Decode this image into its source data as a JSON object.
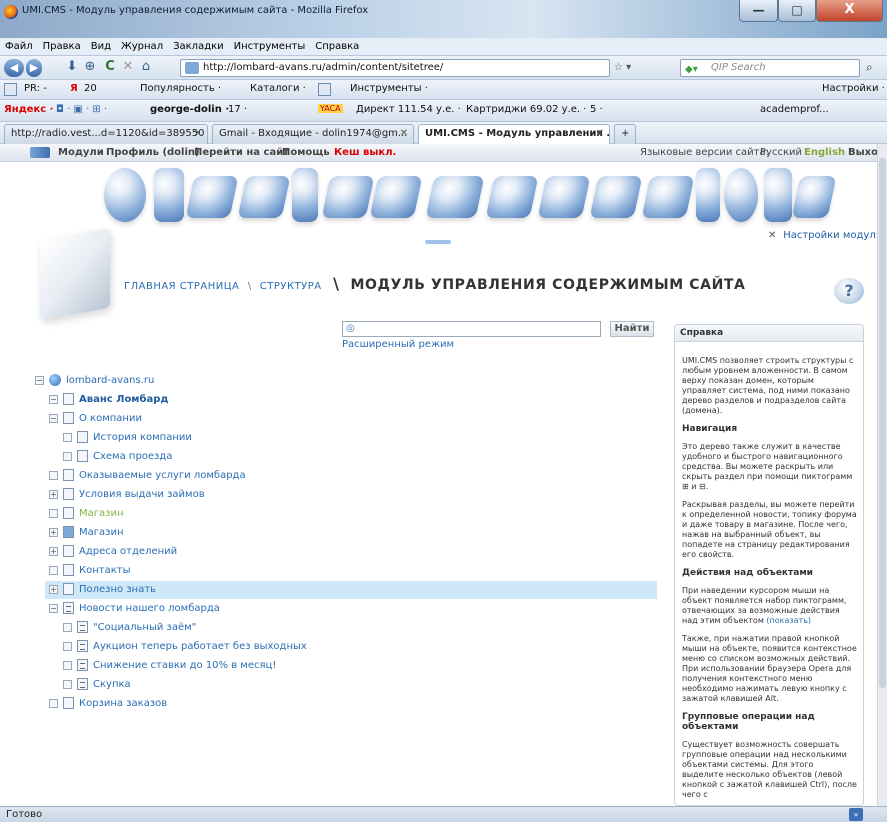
{
  "window": {
    "title": "UMI.CMS - Модуль управления содержимым сайта - Mozilla Firefox",
    "min": "—",
    "max": "□",
    "close": "X"
  },
  "menu": [
    "Файл",
    "Правка",
    "Вид",
    "Журнал",
    "Закладки",
    "Инструменты",
    "Справка"
  ],
  "nav": {
    "url": "http://lombard-avans.ru/admin/content/sitetree/",
    "search_placeholder": "QIP Search",
    "reload": "C",
    "stop": "✕",
    "home": "⌂"
  },
  "toolbar2": {
    "pr": "PR: -",
    "ya": "20",
    "popularity": "Популярность ·",
    "catalogs": "Каталоги ·",
    "tools": "Инструменты ·",
    "settings": "Настройки ·"
  },
  "yabar": {
    "yandex": "Яндекс ·",
    "user": "george-dolin ·",
    "mail": "17 ·",
    "yaca": "YACA",
    "direct": "Директ 111.54 у.е. ·",
    "cartridges": "Картриджи 69.02 у.е. ·",
    "five": "5 ·",
    "acad": "academprof..."
  },
  "tabs": [
    {
      "label": "http://radio.vest...d=1120&id=389550"
    },
    {
      "label": "Gmail - Входящие - dolin1974@gm..."
    },
    {
      "label": "UMI.CMS - Модуль управления ..."
    }
  ],
  "umi": {
    "modules": "Модули",
    "profile": "Профиль (dolin)",
    "goto_site": "Перейти на сайт",
    "help": "Помощь",
    "cache": "Кеш выкл.",
    "lang_label": "Языковые версии сайта:",
    "lang_ru": "Русский",
    "lang_en": "English",
    "exit": "Выход"
  },
  "module_icons": [
    "content-module-icon",
    "news-module-icon",
    "forum-module-icon",
    "email-module-icon",
    "microphone-module-icon",
    "stats-module-icon",
    "catalog-module-icon",
    "faq-module-icon",
    "dispatch-module-icon",
    "banner-module-icon",
    "orders-module-icon",
    "data-module-icon",
    "users-module-icon",
    "config-module-icon",
    "trash-module-icon",
    "files-module-icon"
  ],
  "page": {
    "settings_link": "Настройки модуля",
    "crumb_home": "ГЛАВНАЯ СТРАНИЦА",
    "crumb_sep": "\\",
    "crumb_structure": "СТРУКТУРА",
    "crumb_bigsep": "\\",
    "title": "МОДУЛЬ УПРАВЛЕНИЯ СОДЕРЖИМЫМ САЙТА",
    "find": "Найти",
    "advanced": "Расширенный режим"
  },
  "tree": [
    {
      "label": "lombard-avans.ru",
      "style": "normal"
    },
    {
      "label": "Аванс Ломбард",
      "style": "bold"
    },
    {
      "label": "О компании",
      "style": "normal"
    },
    {
      "label": "История компании",
      "style": "normal"
    },
    {
      "label": "Схема проезда",
      "style": "normal"
    },
    {
      "label": "Оказываемые услуги ломбарда",
      "style": "normal"
    },
    {
      "label": "Условия выдачи займов",
      "style": "normal"
    },
    {
      "label": "Магазин",
      "style": "green"
    },
    {
      "label": "Магазин",
      "style": "normal"
    },
    {
      "label": "Адреса отделений",
      "style": "normal"
    },
    {
      "label": "Контакты",
      "style": "normal"
    },
    {
      "label": "Полезно знать",
      "style": "normal"
    },
    {
      "label": "Новости нашего ломбарда",
      "style": "normal"
    },
    {
      "label": "\"Социальный заём\"",
      "style": "normal"
    },
    {
      "label": "Аукцион теперь работает без выходных",
      "style": "normal"
    },
    {
      "label": "Снижение ставки до 10% в месяц!",
      "style": "normal"
    },
    {
      "label": "Скупка",
      "style": "normal"
    },
    {
      "label": "Корзина заказов",
      "style": "normal"
    }
  ],
  "helppanel": {
    "title": "Справка",
    "p1": "UMI.CMS позволяет строить структуры с любым уровнем вложенности. В самом верху показан домен, которым управляет система, под ними показано дерево разделов и подразделов сайта (домена).",
    "h_nav": "Навигация",
    "p2": "Это дерево также служит в качестве удобного и быстрого навигационного средства. Вы можете раскрыть или скрыть раздел при помощи пиктограмм ⊞ и ⊟.",
    "p3": "Раскрывая разделы, вы можете перейти к определенной новости, топику форума и даже товару в магазине. После чего, нажав на выбранный объект, вы попадете на страницу редактирования его свойств.",
    "h_actions": "Действия над объектами",
    "p4": "При наведении курсором мыши на объект появляется набор пиктограмм, отвечающих за возможные действия над этим объектом",
    "show": "(показать)",
    "p5": "Также, при нажатии правой кнопкой мыши на объекте, появится контекстное меню со списком возможных действий. При использовании браузера Opera для получения контекстного меню необходимо нажимать левую кнопку с зажатой клавишей Alt.",
    "h_group": "Групповые операции над объектами",
    "p6": "Существует возможность совершать групповые операции над несколькими объектами системы. Для этого выделите несколько объектов (левой кнопкой с зажатой клавишей Ctrl), после чего с"
  },
  "status": "Готово"
}
